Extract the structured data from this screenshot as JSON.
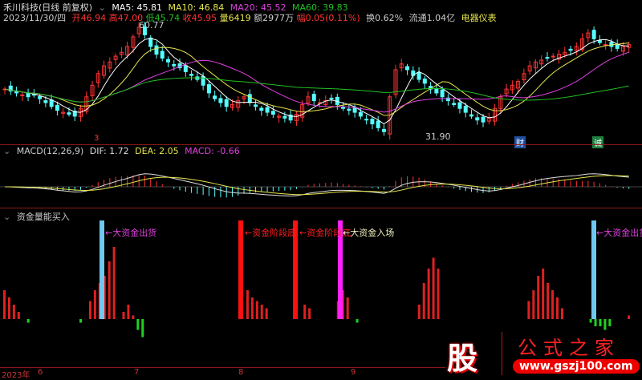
{
  "header": {
    "title": "禾川科技(日线 前复权)",
    "ma5": "MA5: 45.81",
    "ma10": "MA10: 46.84",
    "ma20": "MA20: 45.52",
    "ma60": "MA60: 39.83",
    "date": "2023/11/30/四",
    "open": "开46.94",
    "high": "高47.00",
    "low": "低45.74",
    "close": "收45.95",
    "vol": "量6419",
    "amount": "额2977万",
    "change": "幅0.05(0.11%)",
    "turnover": "换0.62%",
    "float": "流通1.04亿",
    "sector": "电器仪表"
  },
  "price_labels": {
    "max": "60.77",
    "min": "31.90"
  },
  "markers": {
    "m1": "3",
    "m2": "财",
    "m3": "诚"
  },
  "macd": {
    "title": "MACD(12,26,9)",
    "dif": "DIF: 1.72",
    "dea": "DEA: 2.05",
    "macd": "MACD: -0.66"
  },
  "fund": {
    "title": "资金量能买入",
    "s1": "←大资金出货",
    "s2": "←资金阶段底",
    "s3": "←资金阶段底",
    "s4": "←大资金入场",
    "s5": "←大资金出货"
  },
  "axis": {
    "year": "2023年",
    "m6": "6",
    "m7": "7",
    "m8": "8",
    "m9": "9"
  },
  "logo": {
    "char": "股",
    "name": "公式之家",
    "url": "www.gszj100.com"
  },
  "colors": {
    "up": "#ff3232",
    "down": "#54ffff",
    "ma5": "#ffffff",
    "ma10": "#e6e64c",
    "ma20": "#e040e0",
    "ma60": "#22c022"
  },
  "chart_data": {
    "type": "candlestick",
    "closes": [
      44,
      43.5,
      43,
      42.5,
      42,
      42.6,
      41.5,
      40.5,
      39.5,
      38.5,
      38,
      37.5,
      37,
      39,
      42,
      45,
      48,
      50,
      51,
      52.5,
      53.5,
      55,
      57.5,
      60,
      58,
      55,
      53,
      52,
      51,
      50,
      49.5,
      48.5,
      47.5,
      46.5,
      45,
      43,
      41.5,
      40.5,
      39.5,
      40,
      41,
      42,
      40.5,
      39.5,
      38.5,
      38,
      37.5,
      37,
      36.5,
      36,
      37.5,
      40,
      42,
      41,
      40.5,
      41,
      41.5,
      40,
      39,
      38.5,
      38,
      37,
      36,
      35,
      34,
      33,
      42,
      49,
      50.5,
      49,
      47.5,
      46.5,
      45.5,
      44,
      43,
      42,
      41,
      40,
      39,
      38,
      37,
      36,
      35.5,
      36.5,
      39,
      42,
      44,
      45,
      46,
      48,
      50,
      51,
      51.5,
      52,
      52.5,
      53,
      53.5,
      54,
      55,
      57,
      58.5,
      57,
      56,
      55.5,
      55,
      54.5,
      55,
      55.5
    ],
    "fund_bars": [
      8,
      6,
      4,
      2,
      0,
      -1,
      0,
      0,
      0,
      0,
      0,
      0,
      0,
      0,
      0,
      0,
      -1,
      0,
      5,
      8,
      10,
      12,
      16,
      20,
      0,
      2,
      4,
      1,
      -3,
      -5,
      0,
      0,
      0,
      0,
      0,
      0,
      0,
      0,
      0,
      0,
      0,
      0,
      0,
      0,
      0,
      0,
      0,
      0,
      0,
      0,
      0,
      8,
      6,
      5,
      4,
      3,
      0,
      0,
      0,
      0,
      0,
      0,
      0,
      4,
      3,
      0,
      0,
      0,
      0,
      0,
      5,
      8,
      6,
      0,
      -1,
      0,
      0,
      0,
      0,
      0,
      0,
      0,
      0,
      0,
      0,
      0,
      0,
      4,
      10,
      14,
      17,
      14,
      0,
      0,
      0,
      0,
      0,
      0,
      0,
      0,
      0,
      0,
      0,
      0,
      0,
      0,
      0,
      0,
      0,
      0,
      5,
      8,
      12,
      14,
      10,
      8,
      6,
      3,
      0,
      0,
      0,
      0,
      0,
      -1,
      -2,
      -2,
      -3,
      -2,
      0,
      0,
      0,
      1,
      0
    ]
  }
}
